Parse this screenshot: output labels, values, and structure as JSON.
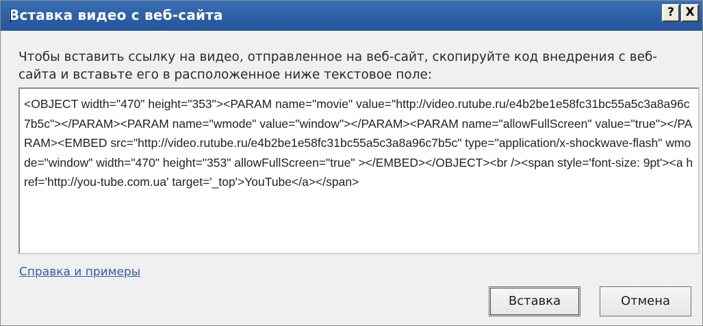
{
  "window": {
    "title": "Вставка видео с веб-сайта",
    "help_button": "?",
    "close_button": "X"
  },
  "instruction": "Чтобы вставить ссылку на видео, отправленное на веб-сайт, скопируйте код внедрения с веб-сайта и вставьте его в расположенное ниже текстовое поле:",
  "embed_code": {
    "value": "<OBJECT width=\"470\" height=\"353\"><PARAM name=\"movie\" value=\"http://video.rutube.ru/e4b2be1e58fc31bc55a5c3a8a96c7b5c\"></PARAM><PARAM name=\"wmode\" value=\"window\"></PARAM><PARAM name=\"allowFullScreen\" value=\"true\"></PARAM><EMBED src=\"http://video.rutube.ru/e4b2be1e58fc31bc55a5c3a8a96c7b5c\" type=\"application/x-shockwave-flash\" wmode=\"window\" width=\"470\" height=\"353\" allowFullScreen=\"true\" ></EMBED></OBJECT><br /><span style='font-size: 9pt'><a href='http://you-tube.com.ua' target='_top'>YouTube</a></span>"
  },
  "help_link": "Справка и примеры",
  "buttons": {
    "insert": "Вставка",
    "cancel": "Отмена"
  },
  "colors": {
    "titlebar": "#2f62a8",
    "link": "#2e5ea9",
    "background": "#f0f0f0"
  }
}
